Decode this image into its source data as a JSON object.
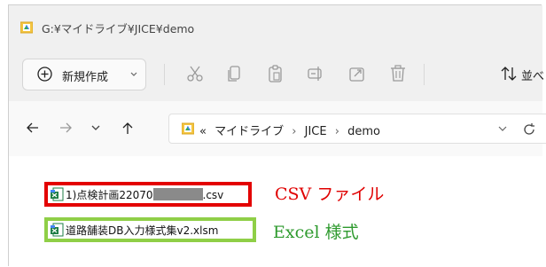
{
  "window": {
    "title": "G:¥マイドライブ¥JICE¥demo"
  },
  "toolbar": {
    "new_label": "新規作成",
    "sort_label": "並べ"
  },
  "address": {
    "overflow": "«",
    "crumbs": [
      "マイドライブ",
      "JICE",
      "demo"
    ],
    "separator": "›"
  },
  "files": [
    {
      "name_prefix": "1)点検計画22070",
      "name_suffix": ".csv",
      "icon": "spreadsheet-file-icon"
    },
    {
      "name": "道路舗装DB入力様式集v2.xlsm",
      "icon": "spreadsheet-file-icon"
    }
  ],
  "annotations": {
    "csv": "CSV ファイル",
    "excel": "Excel 様式"
  },
  "colors": {
    "csv_highlight": "#e30000",
    "excel_highlight": "#8fcf47",
    "csv_text": "#e00000",
    "excel_text": "#2e9a2e"
  }
}
